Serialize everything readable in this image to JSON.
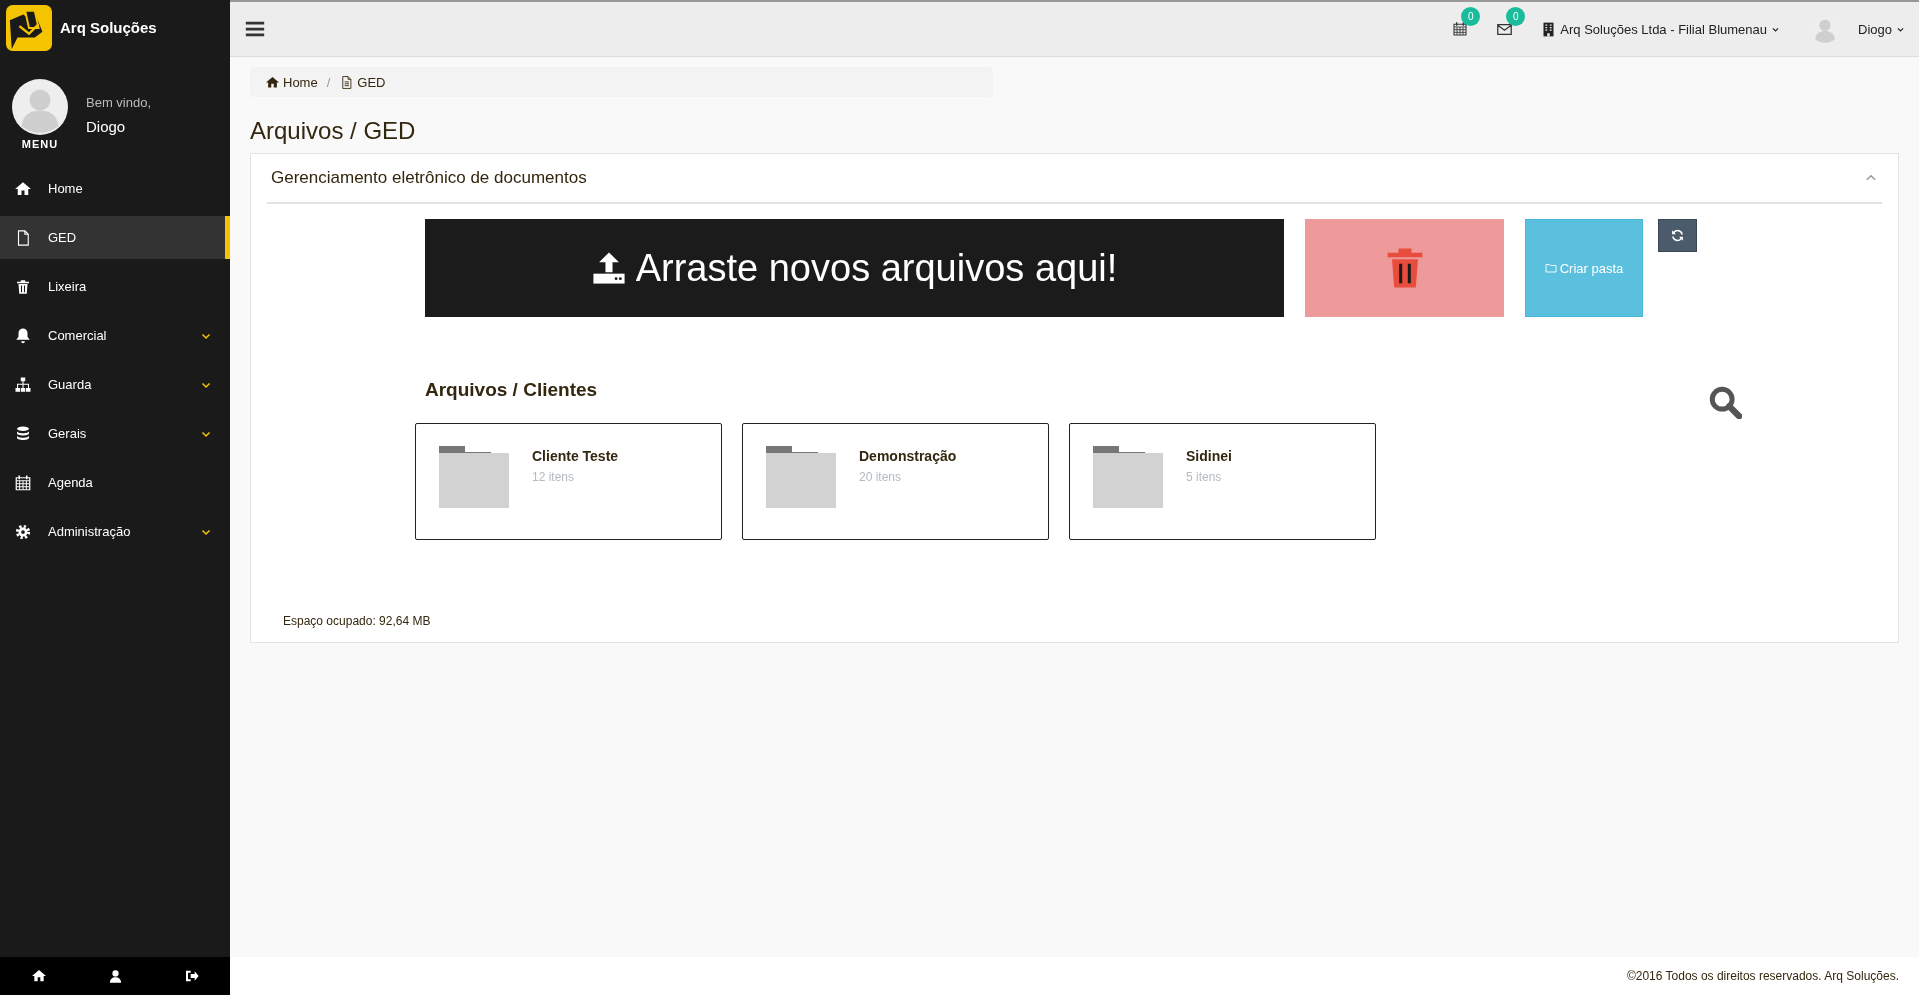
{
  "app": {
    "name": "Arq Soluções"
  },
  "user": {
    "greeting": "Bem vindo,",
    "name": "Diogo",
    "menu_label": "MENU"
  },
  "sidebar": {
    "items": [
      {
        "label": "Home",
        "selected": false,
        "expandable": false
      },
      {
        "label": "GED",
        "selected": true,
        "expandable": false
      },
      {
        "label": "Lixeira",
        "selected": false,
        "expandable": false
      },
      {
        "label": "Comercial",
        "selected": false,
        "expandable": true
      },
      {
        "label": "Guarda",
        "selected": false,
        "expandable": true
      },
      {
        "label": "Gerais",
        "selected": false,
        "expandable": true
      },
      {
        "label": "Agenda",
        "selected": false,
        "expandable": false
      },
      {
        "label": "Administração",
        "selected": false,
        "expandable": true
      }
    ]
  },
  "topbar": {
    "calendar_count": "0",
    "messages_count": "0",
    "company": "Arq Soluções Ltda - Filial Blumenau",
    "user": "Diogo"
  },
  "breadcrumb": {
    "separator": "/",
    "items": [
      {
        "label": "Home"
      },
      {
        "label": "GED"
      }
    ]
  },
  "page_title": "Arquivos / GED",
  "panel": {
    "title": "Gerenciamento eletrônico de documentos",
    "dropzone": "Arraste novos arquivos aqui!",
    "create_folder": "Criar pasta",
    "folders_title": "Arquivos / Clientes",
    "folders": [
      {
        "name": "Cliente Teste",
        "count": "12 itens"
      },
      {
        "name": "Demonstração",
        "count": "20 itens"
      },
      {
        "name": "Sidinei",
        "count": "5 itens"
      }
    ],
    "storage": "Espaço ocupado: 92,64 MB"
  },
  "footer": "©2016 Todos os direitos reservados. Arq Soluções."
}
